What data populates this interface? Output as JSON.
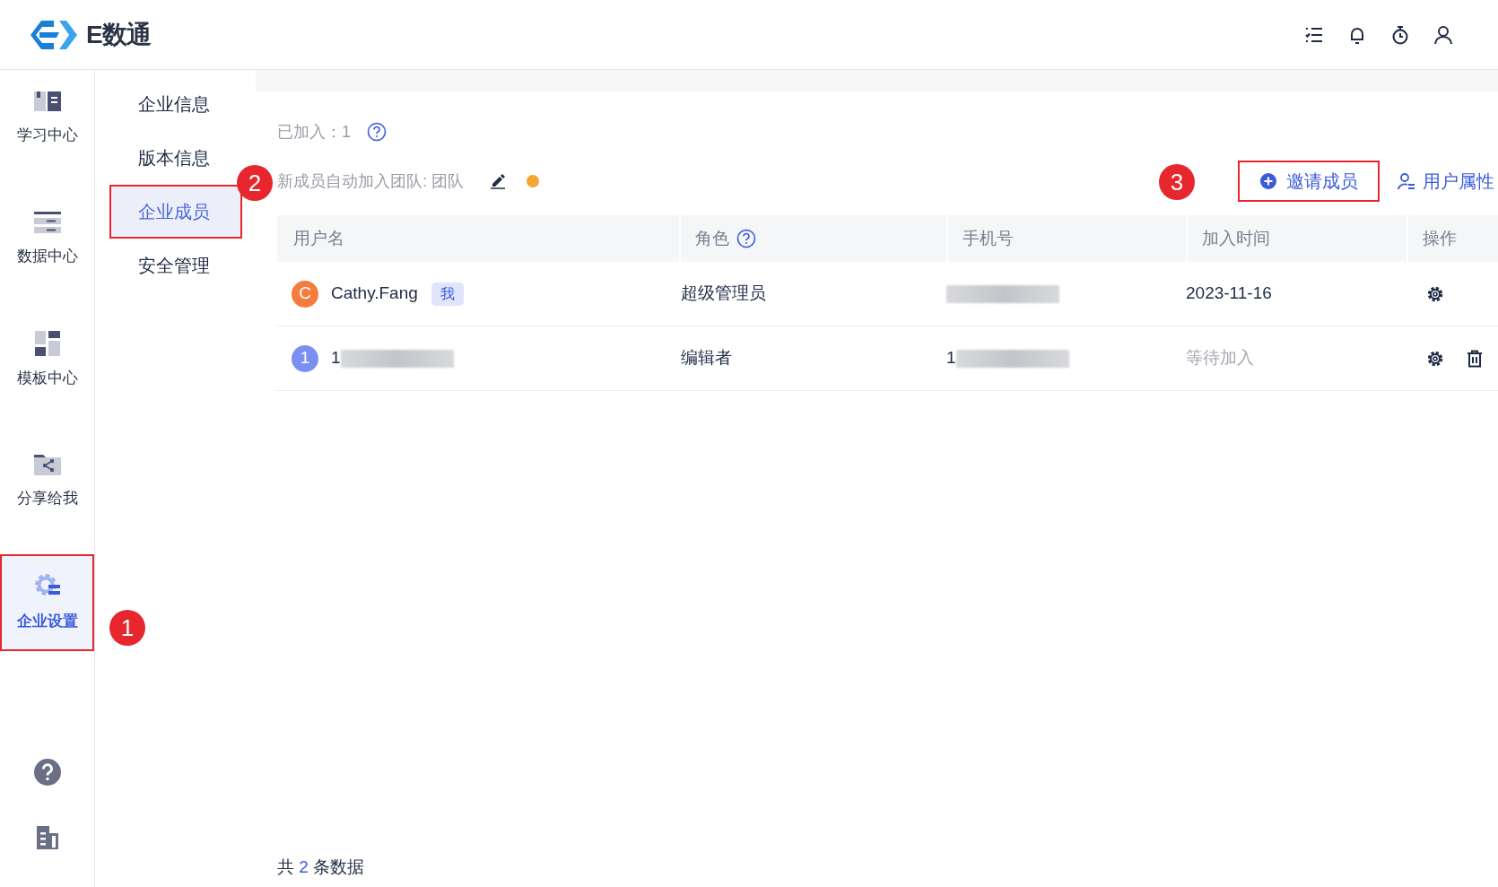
{
  "header": {
    "logo_text": "E数通"
  },
  "sidebar": {
    "items": [
      {
        "label": "学习中心",
        "kind": "book",
        "selected": false
      },
      {
        "label": "数据中心",
        "kind": "data",
        "selected": false
      },
      {
        "label": "模板中心",
        "kind": "template",
        "selected": false
      },
      {
        "label": "分享给我",
        "kind": "share",
        "selected": false
      },
      {
        "label": "企业设置",
        "kind": "settings",
        "selected": true,
        "callout": "1"
      }
    ]
  },
  "subnav": {
    "items": [
      {
        "label": "企业信息",
        "selected": false
      },
      {
        "label": "版本信息",
        "selected": false
      },
      {
        "label": "企业成员",
        "selected": true,
        "callout": "2"
      },
      {
        "label": "安全管理",
        "selected": false
      }
    ]
  },
  "summary": {
    "joined": "已加入：1",
    "auto_join": "新成员自动加入团队: 团队"
  },
  "actions": [
    {
      "label": "邀请成员",
      "kind": "invite",
      "callout": "3"
    },
    {
      "label": "用户属性",
      "kind": "attributes"
    }
  ],
  "table": {
    "columns": [
      {
        "label": "用户名"
      },
      {
        "label": "角色",
        "help": true
      },
      {
        "label": "手机号"
      },
      {
        "label": "加入时间"
      },
      {
        "label": "操作"
      }
    ],
    "rows": [
      {
        "avatar": "C",
        "color": "#f47c3c",
        "name": "Cathy.Fang",
        "tag": "我",
        "role": "超级管理员",
        "phone_redacted": true,
        "joined": "2023-11-16",
        "pending": false,
        "ops": [
          {
            "kind": "settings"
          }
        ]
      },
      {
        "avatar": "1",
        "color": "#7b8ff0",
        "name": "1",
        "name_redacted": true,
        "role": "编辑者",
        "phone": "1",
        "phone_redacted": true,
        "joined": "等待加入",
        "pending": true,
        "ops": [
          {
            "kind": "settings"
          },
          {
            "kind": "delete"
          }
        ]
      }
    ]
  },
  "footer": {
    "prefix": "共",
    "count": "2",
    "suffix": "条数据"
  }
}
